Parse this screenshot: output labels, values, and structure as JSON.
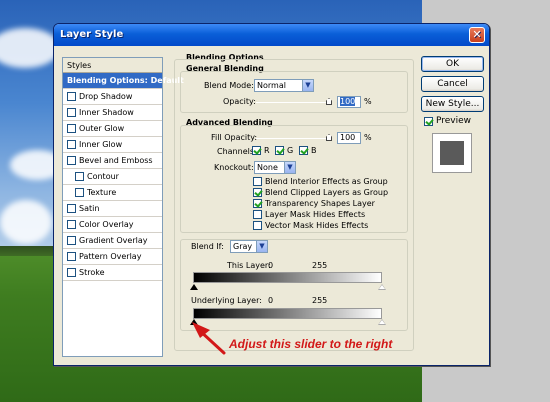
{
  "window": {
    "title": "Layer Style"
  },
  "styles_panel": {
    "header": "Styles",
    "items": [
      {
        "label": "Blending Options: Default",
        "selected": true,
        "checkbox": false,
        "checked": false,
        "indent": false
      },
      {
        "label": "Drop Shadow",
        "selected": false,
        "checkbox": true,
        "checked": false,
        "indent": false
      },
      {
        "label": "Inner Shadow",
        "selected": false,
        "checkbox": true,
        "checked": false,
        "indent": false
      },
      {
        "label": "Outer Glow",
        "selected": false,
        "checkbox": true,
        "checked": false,
        "indent": false
      },
      {
        "label": "Inner Glow",
        "selected": false,
        "checkbox": true,
        "checked": false,
        "indent": false
      },
      {
        "label": "Bevel and Emboss",
        "selected": false,
        "checkbox": true,
        "checked": false,
        "indent": false
      },
      {
        "label": "Contour",
        "selected": false,
        "checkbox": true,
        "checked": false,
        "indent": true
      },
      {
        "label": "Texture",
        "selected": false,
        "checkbox": true,
        "checked": false,
        "indent": true
      },
      {
        "label": "Satin",
        "selected": false,
        "checkbox": true,
        "checked": false,
        "indent": false
      },
      {
        "label": "Color Overlay",
        "selected": false,
        "checkbox": true,
        "checked": false,
        "indent": false
      },
      {
        "label": "Gradient Overlay",
        "selected": false,
        "checkbox": true,
        "checked": false,
        "indent": false
      },
      {
        "label": "Pattern Overlay",
        "selected": false,
        "checkbox": true,
        "checked": false,
        "indent": false
      },
      {
        "label": "Stroke",
        "selected": false,
        "checkbox": true,
        "checked": false,
        "indent": false
      }
    ]
  },
  "blending_options": {
    "title": "Blending Options",
    "general": {
      "title": "General Blending",
      "blend_mode_label": "Blend Mode:",
      "blend_mode_value": "Normal",
      "opacity_label": "Opacity:",
      "opacity_value": "100",
      "opacity_unit": "%"
    },
    "advanced": {
      "title": "Advanced Blending",
      "fill_opacity_label": "Fill Opacity:",
      "fill_opacity_value": "100",
      "fill_opacity_unit": "%",
      "channels_label": "Channels:",
      "channels": [
        {
          "label": "R",
          "checked": true
        },
        {
          "label": "G",
          "checked": true
        },
        {
          "label": "B",
          "checked": true
        }
      ],
      "knockout_label": "Knockout:",
      "knockout_value": "None",
      "options": [
        {
          "label": "Blend Interior Effects as Group",
          "checked": false
        },
        {
          "label": "Blend Clipped Layers as Group",
          "checked": true
        },
        {
          "label": "Transparency Shapes Layer",
          "checked": true
        },
        {
          "label": "Layer Mask Hides Effects",
          "checked": false
        },
        {
          "label": "Vector Mask Hides Effects",
          "checked": false
        }
      ]
    },
    "blend_if": {
      "label": "Blend If:",
      "value": "Gray",
      "this_layer": {
        "label": "This Layer:",
        "min": "0",
        "max": "255"
      },
      "underlying_layer": {
        "label": "Underlying Layer:",
        "min": "0",
        "max": "255"
      }
    }
  },
  "buttons": {
    "ok": "OK",
    "cancel": "Cancel",
    "new_style": "New Style...",
    "preview": "Preview",
    "preview_checked": true
  },
  "annotation": {
    "text": "Adjust this slider to the right",
    "color": "#d21818"
  }
}
